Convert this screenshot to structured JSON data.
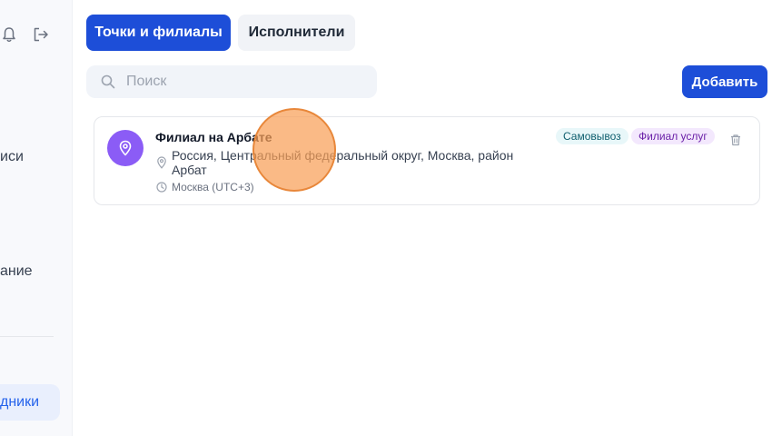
{
  "sidebar": {
    "items": [
      {
        "label": "иси"
      },
      {
        "label": "ание"
      },
      {
        "label": "дники",
        "active": true
      }
    ],
    "icons": [
      "bell-icon",
      "logout-icon"
    ]
  },
  "tabs": [
    {
      "label": "Точки и филиалы",
      "active": true
    },
    {
      "label": "Исполнители",
      "active": false
    }
  ],
  "search": {
    "placeholder": "Поиск",
    "value": ""
  },
  "toolbar": {
    "add_label": "Добавить"
  },
  "branches": [
    {
      "name": "Филиал на Арбате",
      "address": "Россия, Центральный федеральный округ, Москва, район Арбат",
      "timezone": "Москва (UTC+3)",
      "badges": [
        "Самовывоз",
        "Филиал услуг"
      ]
    }
  ],
  "colors": {
    "primary": "#1d4ed8",
    "avatar": "#8b5cf6",
    "badge_pickup_bg": "#e8f7f9",
    "badge_service_bg": "#f3e8fd"
  }
}
